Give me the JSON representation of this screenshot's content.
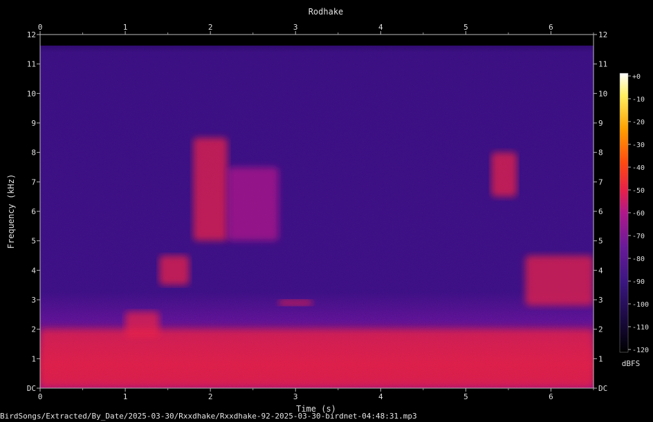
{
  "chart_data": {
    "type": "heatmap",
    "title": "Rodhake",
    "xlabel": "Time (s)",
    "ylabel": "Frequency (kHz)",
    "xlim": [
      0,
      6.5
    ],
    "ylim": [
      0,
      12
    ],
    "x_ticks": [
      "0",
      "1",
      "2",
      "3",
      "4",
      "5",
      "6"
    ],
    "y_ticks": [
      "DC",
      "1",
      "2",
      "3",
      "4",
      "5",
      "6",
      "7",
      "8",
      "9",
      "10",
      "11",
      "12"
    ],
    "colorbar": {
      "label": "dBFS",
      "range": [
        -120,
        0
      ],
      "ticks": [
        "+0",
        "-10",
        "-20",
        "-30",
        "-40",
        "-50",
        "-60",
        "-70",
        "-80",
        "-90",
        "-100",
        "-110",
        "-120"
      ]
    },
    "energy_regions": [
      {
        "t": [
          0.0,
          6.5
        ],
        "f": [
          0.0,
          2.0
        ],
        "level_dbfs": -60
      },
      {
        "t": [
          1.4,
          1.75
        ],
        "f": [
          3.5,
          4.5
        ],
        "level_dbfs": -55
      },
      {
        "t": [
          1.8,
          2.2
        ],
        "f": [
          5.0,
          8.5
        ],
        "level_dbfs": -60
      },
      {
        "t": [
          2.2,
          2.8
        ],
        "f": [
          5.0,
          7.5
        ],
        "level_dbfs": -62
      },
      {
        "t": [
          1.0,
          1.4
        ],
        "f": [
          1.7,
          2.6
        ],
        "level_dbfs": -55
      },
      {
        "t": [
          2.8,
          3.2
        ],
        "f": [
          2.8,
          3.0
        ],
        "level_dbfs": -58
      },
      {
        "t": [
          5.3,
          5.6
        ],
        "f": [
          6.5,
          8.0
        ],
        "level_dbfs": -58
      },
      {
        "t": [
          5.7,
          6.5
        ],
        "f": [
          2.8,
          4.5
        ],
        "level_dbfs": -52
      }
    ]
  },
  "colors": {
    "background": "#000000",
    "base": "#3a1680",
    "colormap": [
      "#000000",
      "#1a0a40",
      "#3a1680",
      "#6a1a9a",
      "#b0188a",
      "#e8204a",
      "#ff4a10",
      "#ffa000",
      "#fff060",
      "#ffffff"
    ]
  },
  "footer": {
    "path": "BirdSongs/Extracted/By_Date/2025-03-30/Rxxdhake/Rxxdhake-92-2025-03-30-birdnet-04:48:31.mp3"
  }
}
